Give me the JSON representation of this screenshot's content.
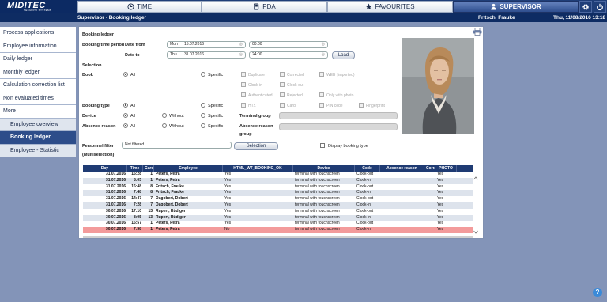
{
  "app": {
    "brand": "MIDITEC",
    "brand_sub": "SECURITY SYSTEMS"
  },
  "nav_tabs": [
    {
      "label": "TIME",
      "icon": "clock-icon"
    },
    {
      "label": "PDA",
      "icon": "pda-icon"
    },
    {
      "label": "FAVOURITES",
      "icon": "star-icon"
    },
    {
      "label": "SUPERVISOR",
      "icon": "person-icon",
      "active": true
    }
  ],
  "header": {
    "title": "Supervisor - Booking ledger",
    "user": "Fritsch, Frauke",
    "datetime": "Thu, 11/08/2016 13:18"
  },
  "sidebar": {
    "items": [
      {
        "label": "Process applications"
      },
      {
        "label": "Employee information"
      },
      {
        "label": "Daily ledger"
      },
      {
        "label": "Monthly ledger"
      },
      {
        "label": "Calculation correction list"
      },
      {
        "label": "Non evaluated times"
      },
      {
        "label": "More"
      },
      {
        "label": "Employee overview"
      },
      {
        "label": "Booking ledger"
      },
      {
        "label": "Employee - Statistic"
      }
    ]
  },
  "form": {
    "section_title": "Booking ledger",
    "period_label": "Booking time period",
    "date_from_label": "Date from",
    "date_to_label": "Date to",
    "from_day": "Mon",
    "from_date": "15.07.2016",
    "from_time": "00:00",
    "to_day": "Thu",
    "to_date": "31.07.2016",
    "to_time": "24:00",
    "load_button": "Load",
    "selection_label": "Selection",
    "book_label": "Book",
    "all": "All",
    "specific": "Specific",
    "without": "Without",
    "book_options": [
      "Duplicate",
      "Corrected",
      "WEB (imported)",
      "Clock-in",
      "Clock-out",
      "Authenticated",
      "Rejected",
      "Only with photo",
      "HTZ",
      "Card",
      "PIN code",
      "Fingerprint"
    ],
    "booking_type_label": "Booking type",
    "device_label": "Device",
    "absence_reason_label": "Absence reason",
    "terminal_group_label": "Terminal group",
    "absence_reason_group_label_1": "Absence reason",
    "absence_reason_group_label_2": "group",
    "personnel_filter_label": "Personnel filter",
    "multiselection_label": "(Multiselection)",
    "personnel_filter_value": "Not filtered",
    "selection_button": "Selection",
    "display_booking_type": "Display booking type"
  },
  "table": {
    "columns": [
      "Day",
      "Time",
      "Card",
      "Employee",
      "HTML_WT_BOOKING_OK",
      "Device",
      "Code",
      "Absence reason",
      "Corr.",
      "PHOTO"
    ],
    "rows": [
      [
        "31.07.2016",
        "16:28",
        "1",
        "Peters, Petra",
        "Yes",
        "terminal with touchscreen",
        "Clock-out",
        "",
        "",
        "Yes"
      ],
      [
        "31.07.2016",
        "8:05",
        "1",
        "Peters, Petra",
        "Yes",
        "terminal with touchscreen",
        "Clock-in",
        "",
        "",
        "Yes"
      ],
      [
        "31.07.2016",
        "16:48",
        "8",
        "Fritsch, Frauke",
        "Yes",
        "terminal with touchscreen",
        "Clock-out",
        "",
        "",
        "Yes"
      ],
      [
        "31.07.2016",
        "7:48",
        "8",
        "Fritsch, Frauke",
        "Yes",
        "terminal with touchscreen",
        "Clock-in",
        "",
        "",
        "Yes"
      ],
      [
        "31.07.2016",
        "14:47",
        "7",
        "Dagobert, Dobert",
        "Yes",
        "terminal with touchscreen",
        "Clock-out",
        "",
        "",
        "Yes"
      ],
      [
        "31.07.2016",
        "7:28",
        "7",
        "Dagobert, Dobert",
        "Yes",
        "terminal with touchscreen",
        "Clock-in",
        "",
        "",
        "Yes"
      ],
      [
        "30.07.2016",
        "17:10",
        "13",
        "Rupert, Rüdiger",
        "Yes",
        "terminal with touchscreen",
        "Clock-out",
        "",
        "",
        "Yes"
      ],
      [
        "30.07.2016",
        "8:05",
        "13",
        "Rupert, Rüdiger",
        "Yes",
        "terminal with touchscreen",
        "Clock-in",
        "",
        "",
        "Yes"
      ],
      [
        "30.07.2016",
        "16:57",
        "1",
        "Peters, Petra",
        "Yes",
        "terminal with touchscreen",
        "Clock-out",
        "",
        "",
        "Yes"
      ],
      [
        "30.07.2016",
        "7:58",
        "1",
        "Peters, Petra",
        "No",
        "terminal with touchscreen",
        "Clock-in",
        "",
        "",
        "Yes"
      ]
    ],
    "selected_row": 9
  },
  "colors": {
    "nav_active": "#2f4f8f",
    "header_bar": "#0e2c63",
    "selected_row": "#f39b9b",
    "background": "#8394b8"
  },
  "help_icon_label": "?"
}
